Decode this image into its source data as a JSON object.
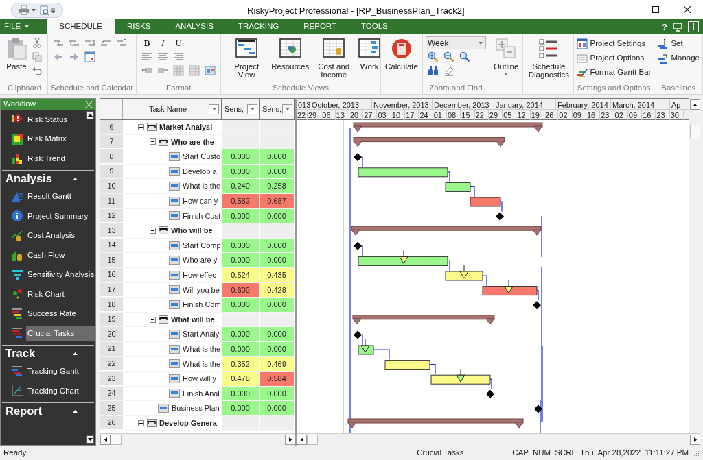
{
  "window": {
    "title": "RiskyProject Professional - [RP_BusinessPlan_Track2]"
  },
  "help_button": "?",
  "menu_tabs": [
    {
      "label": "FILE",
      "selected": false
    },
    {
      "label": "SCHEDULE",
      "selected": true
    },
    {
      "label": "RISKS",
      "selected": false
    },
    {
      "label": "ANALYSIS",
      "selected": false
    },
    {
      "label": "TRACKING",
      "selected": false
    },
    {
      "label": "REPORT",
      "selected": false
    },
    {
      "label": "TOOLS",
      "selected": false
    }
  ],
  "ribbon": {
    "groups": [
      {
        "label": "Clipboard",
        "rows": [
          [
            {
              "kind": "large",
              "label": "Paste"
            },
            {
              "kind": "stack",
              "items": [
                {
                  "kind": "icon"
                },
                {
                  "kind": "icon"
                },
                {
                  "kind": "icon"
                }
              ]
            }
          ]
        ]
      },
      {
        "label": "Schedule and Calendar",
        "rows": [
          [
            {
              "kind": "icon"
            },
            {
              "kind": "icon"
            },
            {
              "kind": "icon"
            },
            {
              "kind": "icon"
            },
            {
              "kind": "icon"
            }
          ],
          [
            {
              "kind": "icon"
            },
            {
              "kind": "icon"
            },
            {
              "kind": "icon"
            }
          ]
        ]
      },
      {
        "label": "Format",
        "rows": [
          [
            {
              "kind": "text",
              "label": "B"
            },
            {
              "kind": "text",
              "label": "I"
            },
            {
              "kind": "text",
              "label": "U"
            }
          ],
          [
            {
              "kind": "icon"
            },
            {
              "kind": "icon"
            },
            {
              "kind": "icon"
            }
          ],
          [
            {
              "kind": "icon"
            },
            {
              "kind": "icon"
            },
            {
              "kind": "icon"
            },
            {
              "kind": "icon"
            },
            {
              "kind": "icon"
            }
          ]
        ]
      },
      {
        "label": "Schedule Views",
        "rows": [
          [
            {
              "kind": "large",
              "label": "Project View"
            },
            {
              "kind": "large",
              "label": "Resources"
            },
            {
              "kind": "large",
              "label": "Cost and Income"
            },
            {
              "kind": "large",
              "label": "Work"
            }
          ]
        ]
      },
      {
        "rows": [
          [
            {
              "kind": "large",
              "label": "Calculate"
            }
          ]
        ]
      },
      {
        "label": "Zoom and Find",
        "rows": [
          [
            {
              "kind": "dropdown",
              "value": "Week"
            }
          ],
          [
            {
              "kind": "icon"
            },
            {
              "kind": "icon"
            },
            {
              "kind": "icon"
            }
          ],
          [
            {
              "kind": "icon"
            },
            {
              "kind": "icon"
            }
          ]
        ]
      },
      {
        "rows": [
          [
            {
              "kind": "large",
              "label": "Outline",
              "caret": true
            }
          ]
        ]
      },
      {
        "rows": [
          [
            {
              "kind": "large",
              "label": "Schedule Diagnostics"
            }
          ]
        ]
      },
      {
        "label": "Settings and Options",
        "rows": [
          [
            {
              "kind": "small",
              "label": "Project Settings"
            }
          ],
          [
            {
              "kind": "small",
              "label": "Project Options"
            }
          ],
          [
            {
              "kind": "small",
              "label": "Format Gantt Bar"
            }
          ]
        ]
      },
      {
        "label": "Baselines",
        "rows": [
          [
            {
              "kind": "small",
              "label": "Set"
            }
          ],
          [
            {
              "kind": "small",
              "label": "Manage"
            }
          ]
        ]
      }
    ]
  },
  "workflow": {
    "title": "Workflow",
    "sections": [
      {
        "items": [
          {
            "label": "Risk Status",
            "selected": false
          },
          {
            "label": "Risk Matrix",
            "selected": false
          },
          {
            "label": "Risk Trend",
            "selected": false
          }
        ]
      },
      {
        "title": "Analysis",
        "expanded": true,
        "items": [
          {
            "label": "Result Gantt",
            "selected": false
          },
          {
            "label": "Project Summary",
            "selected": false
          },
          {
            "label": "Cost Analysis",
            "selected": false
          },
          {
            "label": "Cash Flow",
            "selected": false
          },
          {
            "label": "Sensitivity Analysis",
            "selected": false
          },
          {
            "label": "Risk Chart",
            "selected": false
          },
          {
            "label": "Success Rate",
            "selected": false
          },
          {
            "label": "Crucial Tasks",
            "selected": true
          }
        ]
      },
      {
        "title": "Track",
        "expanded": true,
        "items": [
          {
            "label": "Tracking Gantt",
            "selected": false
          },
          {
            "label": "Tracking Chart",
            "selected": false
          }
        ]
      },
      {
        "title": "Report",
        "expanded": true
      }
    ]
  },
  "table": {
    "columns": [
      "Task Name",
      "Sens,",
      "Sens,"
    ],
    "rows": [
      {
        "number": "6",
        "name": "Market Analysi",
        "kind": "summary",
        "expanded": true,
        "children": [
          {
            "number": "7",
            "name": "Who are the",
            "kind": "summary",
            "expanded": true,
            "children": [
              {
                "number": "8",
                "name": "Start Custo",
                "kind": "task",
                "cells": [
                  {
                    "value": "0.000",
                    "color": "#99f78c"
                  },
                  {
                    "value": "0.000",
                    "color": "#99f78c"
                  }
                ]
              },
              {
                "number": "9",
                "name": "Develop a",
                "kind": "task",
                "cells": [
                  {
                    "value": "0.000",
                    "color": "#99f78c"
                  },
                  {
                    "value": "0.000",
                    "color": "#99f78c"
                  }
                ]
              },
              {
                "number": "10",
                "name": "What is the",
                "kind": "task",
                "cells": [
                  {
                    "value": "0.240",
                    "color": "#99f78c"
                  },
                  {
                    "value": "0.258",
                    "color": "#99f78c"
                  }
                ]
              },
              {
                "number": "11",
                "name": "How can y",
                "kind": "task",
                "cells": [
                  {
                    "value": "0.582",
                    "color": "#f5786b"
                  },
                  {
                    "value": "0.687",
                    "color": "#f5786b"
                  }
                ]
              },
              {
                "number": "12",
                "name": "Finish Cust",
                "kind": "task",
                "cells": [
                  {
                    "value": "0.000",
                    "color": "#99f78c"
                  },
                  {
                    "value": "0.000",
                    "color": "#99f78c"
                  }
                ]
              }
            ]
          },
          {
            "number": "13",
            "name": "Who will be",
            "kind": "summary",
            "expanded": true,
            "children": [
              {
                "number": "14",
                "name": "Start Comp",
                "kind": "task",
                "cells": [
                  {
                    "value": "0.000",
                    "color": "#99f78c"
                  },
                  {
                    "value": "0.000",
                    "color": "#99f78c"
                  }
                ]
              },
              {
                "number": "15",
                "name": "Who are y",
                "kind": "task",
                "cells": [
                  {
                    "value": "0.000",
                    "color": "#99f78c"
                  },
                  {
                    "value": "0.000",
                    "color": "#99f78c"
                  }
                ]
              },
              {
                "number": "16",
                "name": "How effec",
                "kind": "task",
                "cells": [
                  {
                    "value": "0.524",
                    "color": "#fbfb8a"
                  },
                  {
                    "value": "0.435",
                    "color": "#fbfb8a"
                  }
                ]
              },
              {
                "number": "17",
                "name": "Will you be",
                "kind": "task",
                "cells": [
                  {
                    "value": "0.600",
                    "color": "#f5786b"
                  },
                  {
                    "value": "0.428",
                    "color": "#fbfb8a"
                  }
                ]
              },
              {
                "number": "18",
                "name": "Finish Com",
                "kind": "task",
                "cells": [
                  {
                    "value": "0.000",
                    "color": "#99f78c"
                  },
                  {
                    "value": "0.000",
                    "color": "#99f78c"
                  }
                ]
              }
            ]
          },
          {
            "number": "19",
            "name": "What will be",
            "kind": "summary",
            "expanded": true,
            "children": [
              {
                "number": "20",
                "name": "Start Analy",
                "kind": "task",
                "cells": [
                  {
                    "value": "0.000",
                    "color": "#99f78c"
                  },
                  {
                    "value": "0.000",
                    "color": "#99f78c"
                  }
                ]
              },
              {
                "number": "21",
                "name": "What is the",
                "kind": "task",
                "cells": [
                  {
                    "value": "0.000",
                    "color": "#99f78c"
                  },
                  {
                    "value": "0.000",
                    "color": "#99f78c"
                  }
                ]
              },
              {
                "number": "22",
                "name": "What is the",
                "kind": "task",
                "cells": [
                  {
                    "value": "0.352",
                    "color": "#fbfb8a"
                  },
                  {
                    "value": "0.469",
                    "color": "#fbfb8a"
                  }
                ]
              },
              {
                "number": "23",
                "name": "How will y",
                "kind": "task",
                "cells": [
                  {
                    "value": "0.478",
                    "color": "#fbfb8a"
                  },
                  {
                    "value": "0.584",
                    "color": "#f5786b"
                  }
                ]
              },
              {
                "number": "24",
                "name": "Finish Anal",
                "kind": "task",
                "cells": [
                  {
                    "value": "0.000",
                    "color": "#99f78c"
                  },
                  {
                    "value": "0.000",
                    "color": "#99f78c"
                  }
                ]
              }
            ]
          },
          {
            "number": "25",
            "name": "Business Plan",
            "kind": "task",
            "cells": [
              {
                "value": "0.000",
                "color": "#99f78c"
              },
              {
                "value": "0.000",
                "color": "#99f78c"
              }
            ]
          }
        ]
      },
      {
        "number": "26",
        "name": "Develop Genera",
        "kind": "summary",
        "expanded": true
      }
    ]
  },
  "gantt": {
    "months": [
      "013",
      "October, 2013",
      "November, 2013",
      "December, 2013",
      "January, 2014",
      "February, 2014",
      "March, 2014",
      "Ap"
    ],
    "weeks": [
      "22",
      "29",
      "06",
      "13",
      "20",
      "27",
      "03",
      "10",
      "17",
      "24",
      "01",
      "08",
      "15",
      "22",
      "29",
      "05",
      "12",
      "19",
      "26",
      "02",
      "09",
      "16",
      "23",
      "02",
      "09",
      "16",
      "23",
      "30"
    ]
  },
  "status_bar": {
    "message": "Ready",
    "view": "Crucial Tasks",
    "indicators": [
      "CAP",
      "NUM",
      "SCRL"
    ],
    "datetime": "Thu, Apr 28,2022  11:11:27 PM"
  }
}
